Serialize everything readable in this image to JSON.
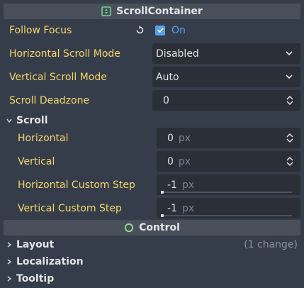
{
  "scroll_container": {
    "header": "ScrollContainer",
    "follow_focus": {
      "label": "Follow Focus",
      "checked": true,
      "value_label": "On"
    },
    "horizontal_scroll_mode": {
      "label": "Horizontal Scroll Mode",
      "value": "Disabled"
    },
    "vertical_scroll_mode": {
      "label": "Vertical Scroll Mode",
      "value": "Auto"
    },
    "scroll_deadzone": {
      "label": "Scroll Deadzone",
      "value": "0"
    },
    "scroll_group": {
      "label": "Scroll",
      "horizontal": {
        "label": "Horizontal",
        "value": "0",
        "unit": "px"
      },
      "vertical": {
        "label": "Vertical",
        "value": "0",
        "unit": "px"
      },
      "horizontal_custom_step": {
        "label": "Horizontal Custom Step",
        "value": "-1",
        "unit": "px"
      },
      "vertical_custom_step": {
        "label": "Vertical Custom Step",
        "value": "-1",
        "unit": "px"
      }
    }
  },
  "control": {
    "header": "Control",
    "groups": [
      {
        "label": "Layout",
        "note": "(1 change)"
      },
      {
        "label": "Localization"
      },
      {
        "label": "Tooltip"
      }
    ]
  },
  "colors": {
    "background": "#363d4a",
    "section_header": "#4a505b",
    "property_label": "#f2d76a",
    "field_bg": "#2a2f38",
    "accent": "#5aa2ed",
    "scroll_container_icon": "#6dd38a",
    "control_icon": "#8de08f"
  },
  "icons": {
    "scroll_container": "scroll-container-node-icon",
    "revert": "revert-icon",
    "checkbox": "checkbox-checked-icon",
    "dropdown": "chevron-down-icon",
    "spinner": "spinner-updown-icon",
    "group": "chevron-right-icon",
    "control": "control-node-icon"
  }
}
